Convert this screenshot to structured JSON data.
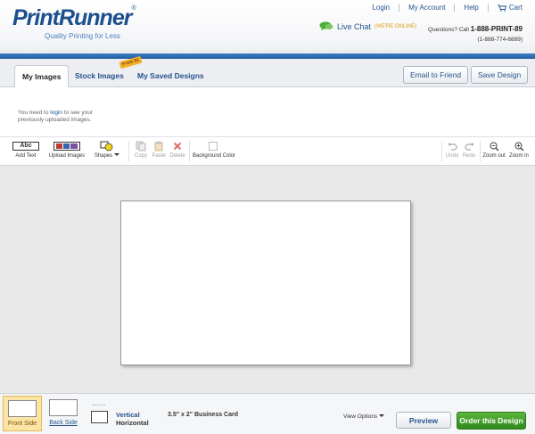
{
  "brand": {
    "logo": "PrintRunner",
    "tagline": "Quality Printing for Less"
  },
  "top_links": {
    "login": "Login",
    "my_account": "My Account",
    "help": "Help",
    "cart": "Cart"
  },
  "live_chat": {
    "label": "Live Chat",
    "status": "(WE'RE ONLINE)"
  },
  "phone": {
    "question": "Questions? Call ",
    "number": "1-888-PRINT-89",
    "alt_number": "(1-888-774-6889)"
  },
  "tabs": [
    {
      "label": "My Images",
      "active": true
    },
    {
      "label": "Stock Images",
      "active": false
    },
    {
      "label": "My Saved Designs",
      "active": false
    }
  ],
  "price_tag": "From $1",
  "header_buttons": {
    "email": "Email to Friend",
    "save": "Save Design"
  },
  "image_pane": {
    "msg_before": "You need to ",
    "login_link": "login",
    "msg_after": " to see your previously uploaded images."
  },
  "toolbar": {
    "add_text": "Add Text",
    "abc": "Abc",
    "upload": "Upload Images",
    "shapes": "Shapes",
    "copy": "Copy",
    "paste": "Paste",
    "delete": "Delete",
    "background": "Background Color",
    "undo": "Undo",
    "redo": "Redo",
    "zoom_out": "Zoom out",
    "zoom_in": "Zoom in"
  },
  "bottom": {
    "front": "Front Side",
    "back": "Back Side",
    "vertical": "Vertical",
    "horizontal": "Horizontal",
    "product": "3.5\" x 2\" Business Card",
    "view_options": "View Options",
    "preview": "Preview",
    "order": "Order this Design"
  },
  "colors": {
    "brand_blue": "#1c4f8d",
    "link_blue": "#24548d",
    "order_green": "#3a9a26",
    "chat_green": "#4caf3a",
    "front_highlight": "#fbe4a6"
  }
}
